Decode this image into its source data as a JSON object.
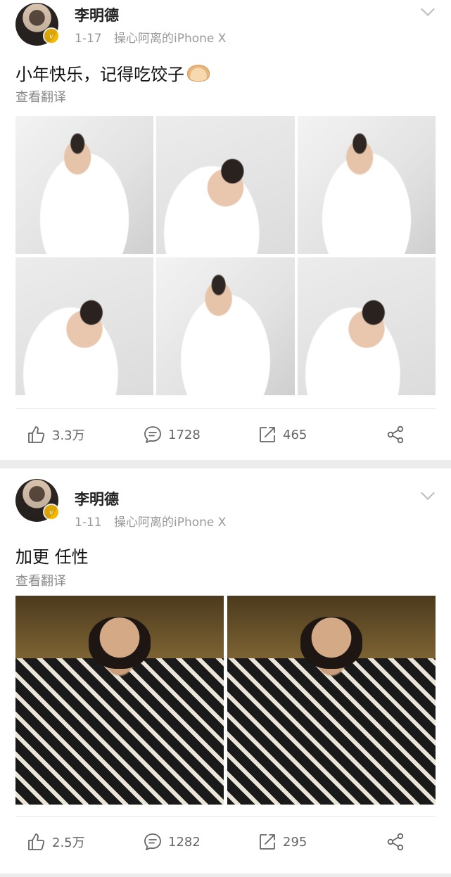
{
  "posts": [
    {
      "username": "李明德",
      "date": "1-17",
      "source": "操心阿离的iPhone X",
      "text": "小年快乐，记得吃饺子",
      "emoji": "dumpling-emoji",
      "translate": "查看翻译",
      "like_count": "3.3万",
      "comment_count": "1728",
      "repost_count": "465"
    },
    {
      "username": "李明德",
      "date": "1-11",
      "source": "操心阿离的iPhone X",
      "text": "加更 任性",
      "translate": "查看翻译",
      "like_count": "2.5万",
      "comment_count": "1282",
      "repost_count": "295"
    }
  ],
  "icons": {
    "verified": "verified-badge-icon",
    "more": "chevron-down-icon",
    "like": "thumb-up-icon",
    "comment": "comment-icon",
    "repost": "share-arrow-icon",
    "share": "share-nodes-icon"
  },
  "colors": {
    "verified_badge": "#f5b800",
    "muted_text": "#999999",
    "divider": "#e6e6e6",
    "page_bg": "#ececec"
  }
}
